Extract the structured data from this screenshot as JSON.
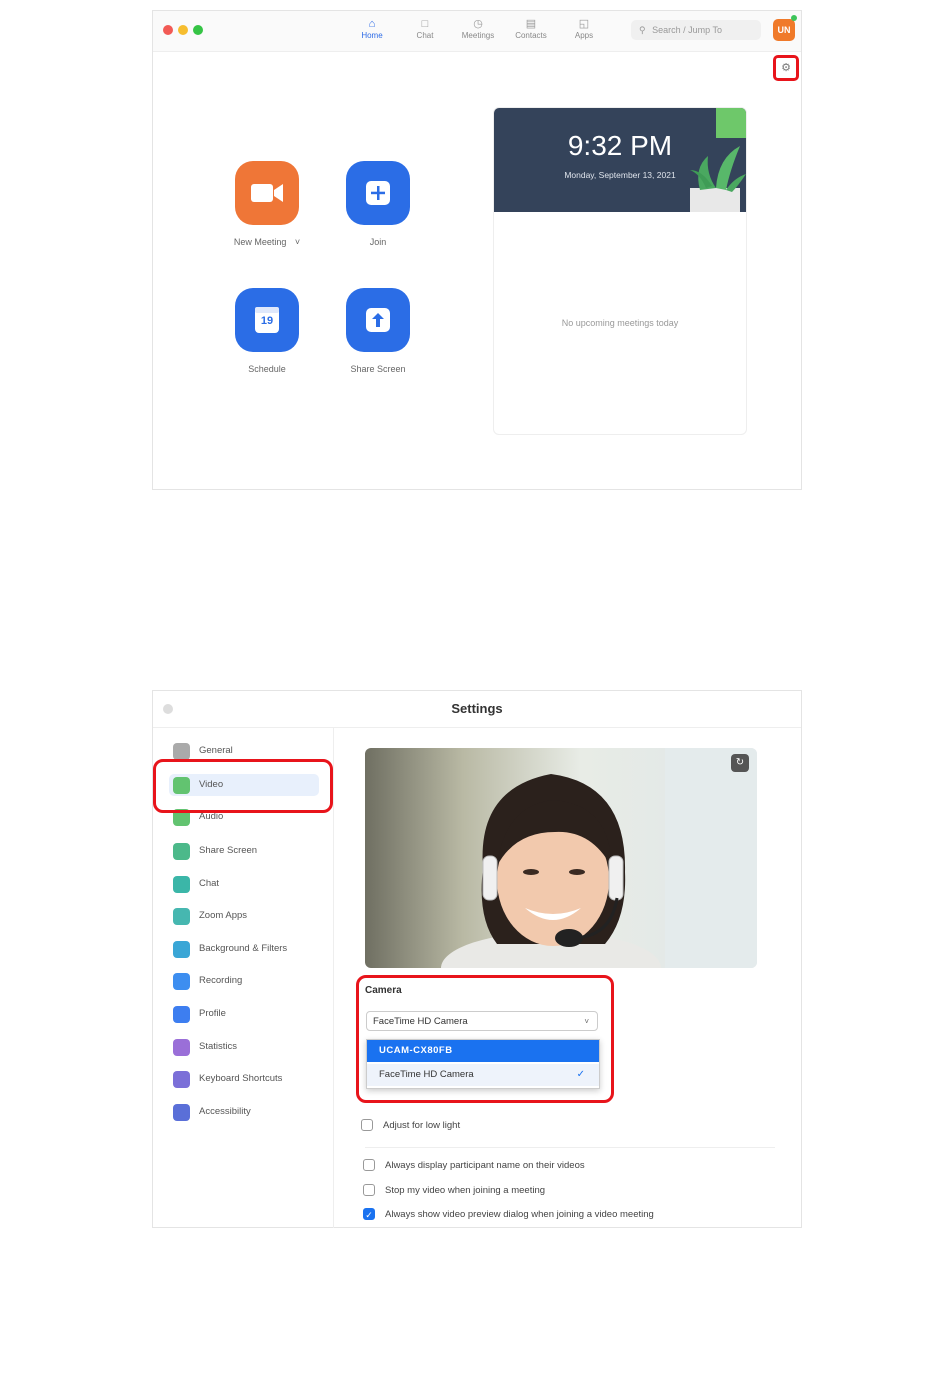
{
  "home": {
    "nav_tabs": [
      {
        "label": "Home",
        "icon": "home-icon"
      },
      {
        "label": "Chat",
        "icon": "chat-icon"
      },
      {
        "label": "Meetings",
        "icon": "clock-icon"
      },
      {
        "label": "Contacts",
        "icon": "contacts-icon"
      },
      {
        "label": "Apps",
        "icon": "apps-icon"
      }
    ],
    "search_placeholder": "Search / Jump To",
    "avatar_initials": "UN",
    "actions": {
      "new_meeting": "New Meeting",
      "join": "Join",
      "schedule": "Schedule",
      "schedule_day": "19",
      "share_screen": "Share Screen"
    },
    "clock": {
      "time": "9:32 PM",
      "date": "Monday, September 13, 2021",
      "empty_text": "No upcoming meetings today"
    }
  },
  "settings": {
    "title": "Settings",
    "sidebar": [
      {
        "label": "General",
        "color": "#aaaaaa"
      },
      {
        "label": "Video",
        "color": "#62c370"
      },
      {
        "label": "Audio",
        "color": "#62c370"
      },
      {
        "label": "Share Screen",
        "color": "#4cb98a"
      },
      {
        "label": "Chat",
        "color": "#3bb6a8"
      },
      {
        "label": "Zoom Apps",
        "color": "#46b7b0"
      },
      {
        "label": "Background & Filters",
        "color": "#3aa6d6"
      },
      {
        "label": "Recording",
        "color": "#3d8ef0"
      },
      {
        "label": "Profile",
        "color": "#3d7ef0"
      },
      {
        "label": "Statistics",
        "color": "#9a6fd8"
      },
      {
        "label": "Keyboard Shortcuts",
        "color": "#7b6fd8"
      },
      {
        "label": "Accessibility",
        "color": "#5a6fd8"
      }
    ],
    "camera_label": "Camera",
    "camera_selected": "FaceTime HD Camera",
    "camera_options": [
      "UCAM-CX80FB",
      "FaceTime HD Camera"
    ],
    "checkboxes": [
      {
        "label": "Adjust for low light",
        "checked": false
      },
      {
        "label": "Always display participant name on their videos",
        "checked": false
      },
      {
        "label": "Stop my video when joining a meeting",
        "checked": false
      },
      {
        "label": "Always show video preview dialog when joining a video meeting",
        "checked": true
      }
    ],
    "accent_color": "#1a72f0",
    "highlight_color": "#e8141b"
  }
}
